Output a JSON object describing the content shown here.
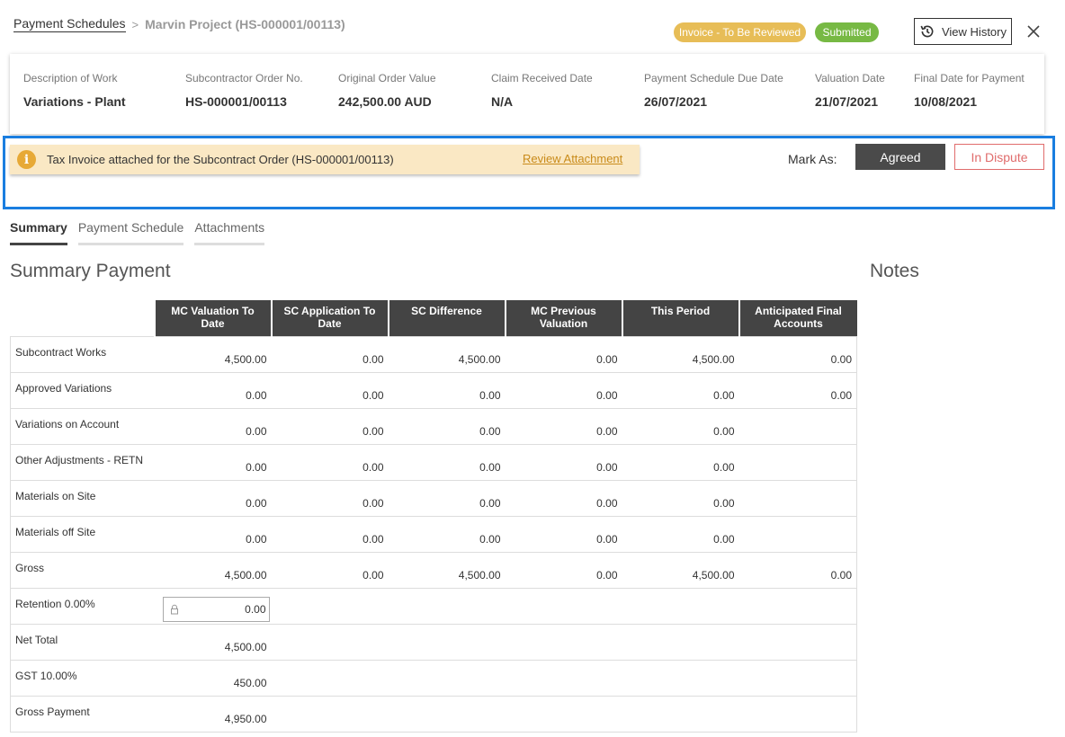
{
  "breadcrumb": {
    "root": "Payment Schedules",
    "separator": ">",
    "current": "Marvin Project (HS-000001/00113)"
  },
  "badges": {
    "review": "Invoice - To Be Reviewed",
    "submitted": "Submitted",
    "review_color": "#e7bd57",
    "submitted_color": "#77b944"
  },
  "actions": {
    "view_history": "View History",
    "history_icon": "history-icon",
    "close_icon": "close-icon"
  },
  "details": [
    {
      "label": "Description of Work",
      "value": "Variations - Plant"
    },
    {
      "label": "Subcontractor Order No.",
      "value": "HS-000001/00113"
    },
    {
      "label": "Original Order Value",
      "value": "242,500.00 AUD"
    },
    {
      "label": "Claim Received Date",
      "value": "N/A"
    },
    {
      "label": "Payment Schedule Due Date",
      "value": "26/07/2021"
    },
    {
      "label": "Valuation Date",
      "value": "21/07/2021"
    },
    {
      "label": "Final Date for Payment",
      "value": "10/08/2021"
    }
  ],
  "alert": {
    "icon": "info-icon",
    "icon_glyph": "i",
    "message": "Tax Invoice attached for the Subcontract Order (HS-000001/00113)",
    "link": "Review Attachment"
  },
  "mark_as": {
    "label": "Mark As:",
    "agreed": "Agreed",
    "in_dispute": "In Dispute"
  },
  "tabs": [
    {
      "label": "Summary",
      "active": true
    },
    {
      "label": "Payment Schedule",
      "active": false
    },
    {
      "label": "Attachments",
      "active": false
    }
  ],
  "summary_title": "Summary Payment",
  "notes_title": "Notes",
  "table": {
    "columns": [
      "MC Valuation To Date",
      "SC Application To Date",
      "SC Difference",
      "MC Previous Valuation",
      "This Period",
      "Anticipated Final Accounts"
    ],
    "rows": [
      {
        "label": "Subcontract Works",
        "values": [
          "4,500.00",
          "0.00",
          "4,500.00",
          "0.00",
          "4,500.00",
          "0.00"
        ]
      },
      {
        "label": "Approved Variations",
        "values": [
          "0.00",
          "0.00",
          "0.00",
          "0.00",
          "0.00",
          "0.00"
        ]
      },
      {
        "label": "Variations on Account",
        "values": [
          "0.00",
          "0.00",
          "0.00",
          "0.00",
          "0.00",
          ""
        ]
      },
      {
        "label": "Other Adjustments - RETN",
        "values": [
          "0.00",
          "0.00",
          "0.00",
          "0.00",
          "0.00",
          ""
        ]
      },
      {
        "label": "Materials on Site",
        "values": [
          "0.00",
          "0.00",
          "0.00",
          "0.00",
          "0.00",
          ""
        ]
      },
      {
        "label": "Materials off Site",
        "values": [
          "0.00",
          "0.00",
          "0.00",
          "0.00",
          "0.00",
          ""
        ]
      },
      {
        "label": "Gross",
        "values": [
          "4,500.00",
          "0.00",
          "4,500.00",
          "0.00",
          "4,500.00",
          "0.00"
        ]
      }
    ],
    "retention": {
      "label": "Retention 0.00%",
      "value": "0.00",
      "icon": "lock-icon"
    },
    "footer_rows": [
      {
        "label": "Net Total",
        "value": "4,500.00"
      },
      {
        "label": "GST 10.00%",
        "value": "450.00"
      },
      {
        "label": "Gross Payment",
        "value": "4,950.00"
      }
    ]
  }
}
